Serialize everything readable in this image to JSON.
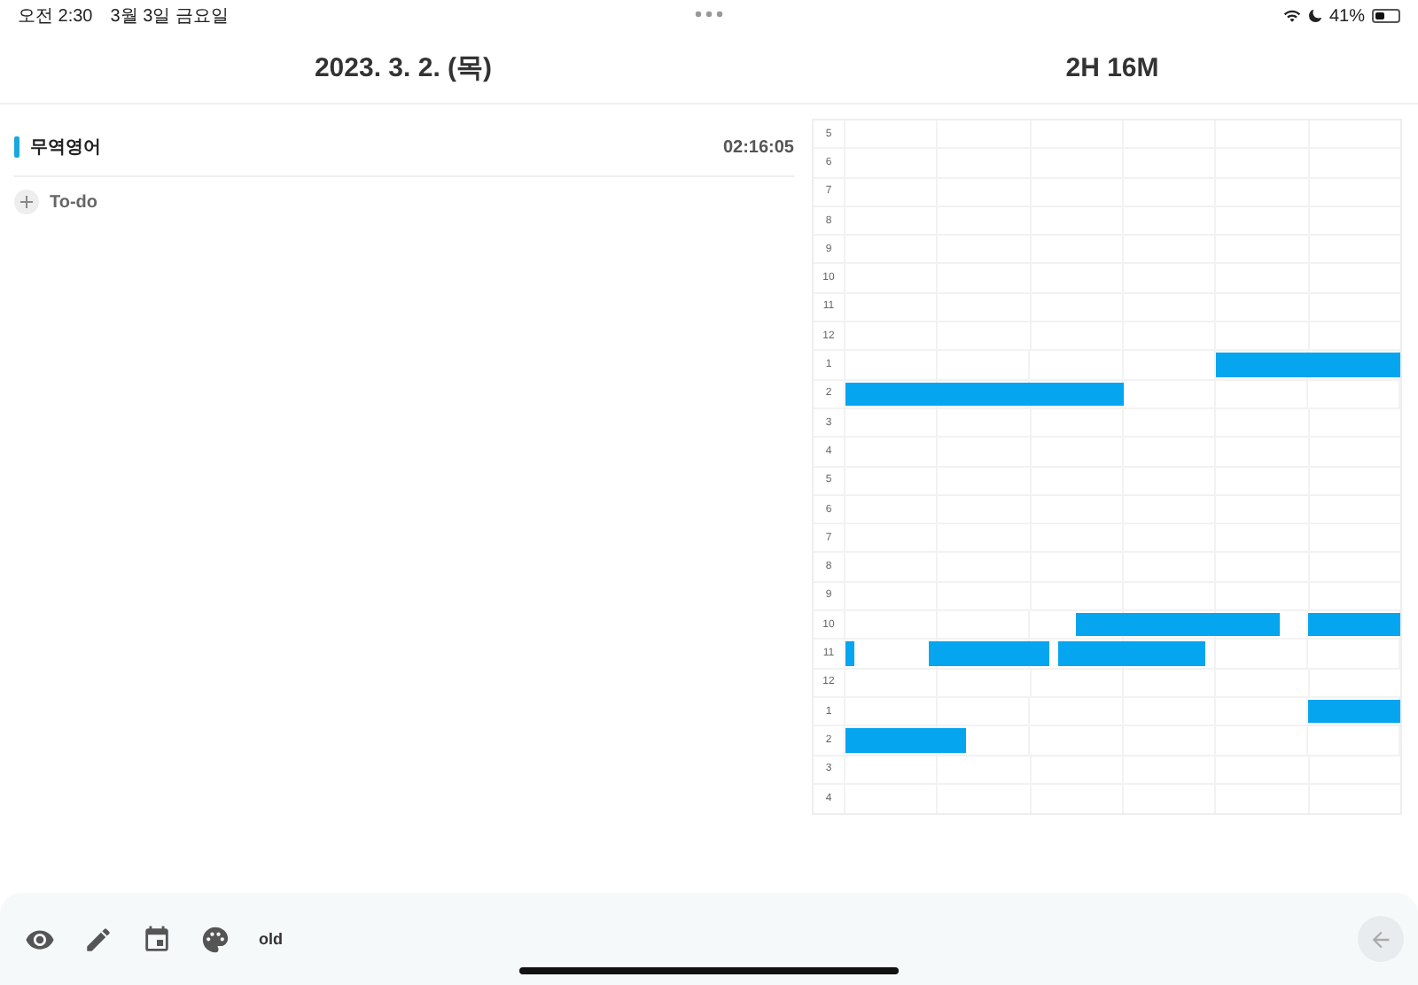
{
  "status_bar": {
    "time": "오전 2:30",
    "date": "3월 3일 금요일",
    "battery": "41%"
  },
  "header": {
    "date_title": "2023. 3. 2. (목)",
    "total_title": "2H 16M"
  },
  "tasks": [
    {
      "name": "무역영어",
      "duration": "02:16:05",
      "color": "#1aa8dc"
    }
  ],
  "todo_label": "To-do",
  "timetable": {
    "hours": [
      "5",
      "6",
      "7",
      "8",
      "9",
      "10",
      "11",
      "12",
      "1",
      "2",
      "3",
      "4",
      "5",
      "6",
      "7",
      "8",
      "9",
      "10",
      "11",
      "12",
      "1",
      "2",
      "3",
      "4"
    ]
  },
  "toolbar": {
    "mode_label": "old"
  }
}
